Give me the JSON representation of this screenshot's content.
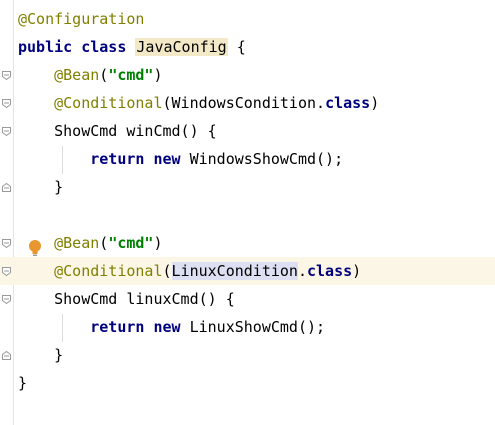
{
  "editor": {
    "lines": [
      {
        "id": "l1",
        "tokens": [
          {
            "t": "@Configuration",
            "c": "ann"
          }
        ]
      },
      {
        "id": "l2",
        "tokens": [
          {
            "t": "public",
            "c": "kw"
          },
          {
            "t": " ",
            "c": ""
          },
          {
            "t": "class",
            "c": "kw"
          },
          {
            "t": " ",
            "c": ""
          },
          {
            "t": "JavaConfig",
            "c": "hl-name"
          },
          {
            "t": " {",
            "c": ""
          }
        ]
      },
      {
        "id": "l3",
        "tokens": [
          {
            "t": "    ",
            "c": ""
          },
          {
            "t": "@Bean",
            "c": "ann"
          },
          {
            "t": "(",
            "c": ""
          },
          {
            "t": "\"cmd\"",
            "c": "str"
          },
          {
            "t": ")",
            "c": ""
          }
        ]
      },
      {
        "id": "l4",
        "tokens": [
          {
            "t": "    ",
            "c": ""
          },
          {
            "t": "@Conditional",
            "c": "ann"
          },
          {
            "t": "(WindowsCondition.",
            "c": ""
          },
          {
            "t": "class",
            "c": "kw"
          },
          {
            "t": ")",
            "c": ""
          }
        ]
      },
      {
        "id": "l5",
        "tokens": [
          {
            "t": "    ShowCmd winCmd() {",
            "c": ""
          }
        ]
      },
      {
        "id": "l6",
        "tokens": [
          {
            "t": "        ",
            "c": ""
          },
          {
            "t": "return",
            "c": "kw"
          },
          {
            "t": " ",
            "c": ""
          },
          {
            "t": "new",
            "c": "kw"
          },
          {
            "t": " WindowsShowCmd();",
            "c": ""
          }
        ]
      },
      {
        "id": "l7",
        "tokens": [
          {
            "t": "    }",
            "c": ""
          }
        ]
      },
      {
        "id": "l8",
        "tokens": []
      },
      {
        "id": "l9",
        "tokens": [
          {
            "t": "    ",
            "c": ""
          },
          {
            "t": "@Bean",
            "c": "ann"
          },
          {
            "t": "(",
            "c": ""
          },
          {
            "t": "\"cmd\"",
            "c": "str"
          },
          {
            "t": ")",
            "c": ""
          }
        ]
      },
      {
        "id": "l10",
        "tokens": [
          {
            "t": "    ",
            "c": ""
          },
          {
            "t": "@Conditional",
            "c": "ann"
          },
          {
            "t": "(",
            "c": ""
          },
          {
            "t": "LinuxCondition",
            "c": "hl-usage"
          },
          {
            "t": ".",
            "c": ""
          },
          {
            "t": "class",
            "c": "kw"
          },
          {
            "t": ")",
            "c": ""
          }
        ]
      },
      {
        "id": "l11",
        "tokens": [
          {
            "t": "    ShowCmd linuxCmd() {",
            "c": ""
          }
        ]
      },
      {
        "id": "l12",
        "tokens": [
          {
            "t": "        ",
            "c": ""
          },
          {
            "t": "return",
            "c": "kw"
          },
          {
            "t": " ",
            "c": ""
          },
          {
            "t": "new",
            "c": "kw"
          },
          {
            "t": " LinuxShowCmd();",
            "c": ""
          }
        ]
      },
      {
        "id": "l13",
        "tokens": [
          {
            "t": "    }",
            "c": ""
          }
        ]
      },
      {
        "id": "l14",
        "tokens": [
          {
            "t": "}",
            "c": ""
          }
        ]
      }
    ],
    "current_line": "l10",
    "intention_icon": "lightbulb-icon",
    "colors": {
      "annotation": "#808000",
      "keyword": "#000080",
      "string": "#008000",
      "current_line_bg": "#fcf6e6",
      "declaration_highlight": "#f3e9c7",
      "usage_highlight": "#dde0f2"
    }
  }
}
